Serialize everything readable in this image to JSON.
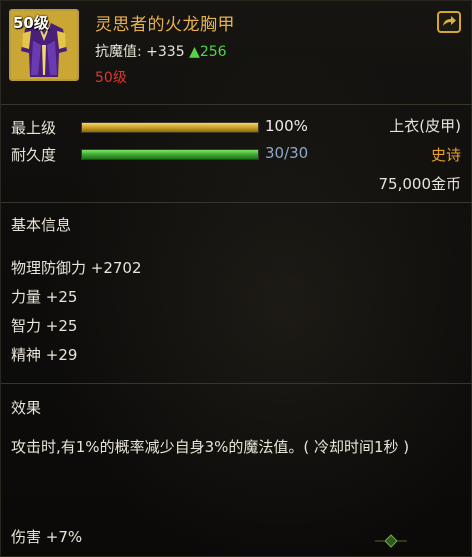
{
  "item": {
    "level_badge": "50级",
    "name": "灵思者的火龙胸甲",
    "stat_label": "抗魔值: +335",
    "stat_up": "▲256",
    "required_level": "50级",
    "slot": "上衣(皮甲)",
    "rarity": "史诗",
    "price": "75,000金币"
  },
  "bars": {
    "upgrade": {
      "label": "最上级",
      "value_text": "100%",
      "fill": 1.0
    },
    "durability": {
      "label": "耐久度",
      "value_text": "30/30",
      "fill": 1.0
    }
  },
  "basic_info": {
    "title": "基本信息",
    "attributes": [
      "物理防御力 +2702",
      "力量 +25",
      "智力 +25",
      "精神 +29"
    ]
  },
  "effect": {
    "title": "效果",
    "text": "攻击时,有1%的概率减少自身3%的魔法值。( 冷却时间1秒 )",
    "extra": "伤害 +7%"
  },
  "icons": [
    "armor-icon",
    "share-icon",
    "ornament-icon"
  ],
  "colors": {
    "title": "#e7b24a",
    "required_level": "#e2362e",
    "stat_up": "#55d24a",
    "rarity": "#e9a32a",
    "upgrade_bar": "#d4a62a",
    "durability_bar": "#3aa52a"
  }
}
